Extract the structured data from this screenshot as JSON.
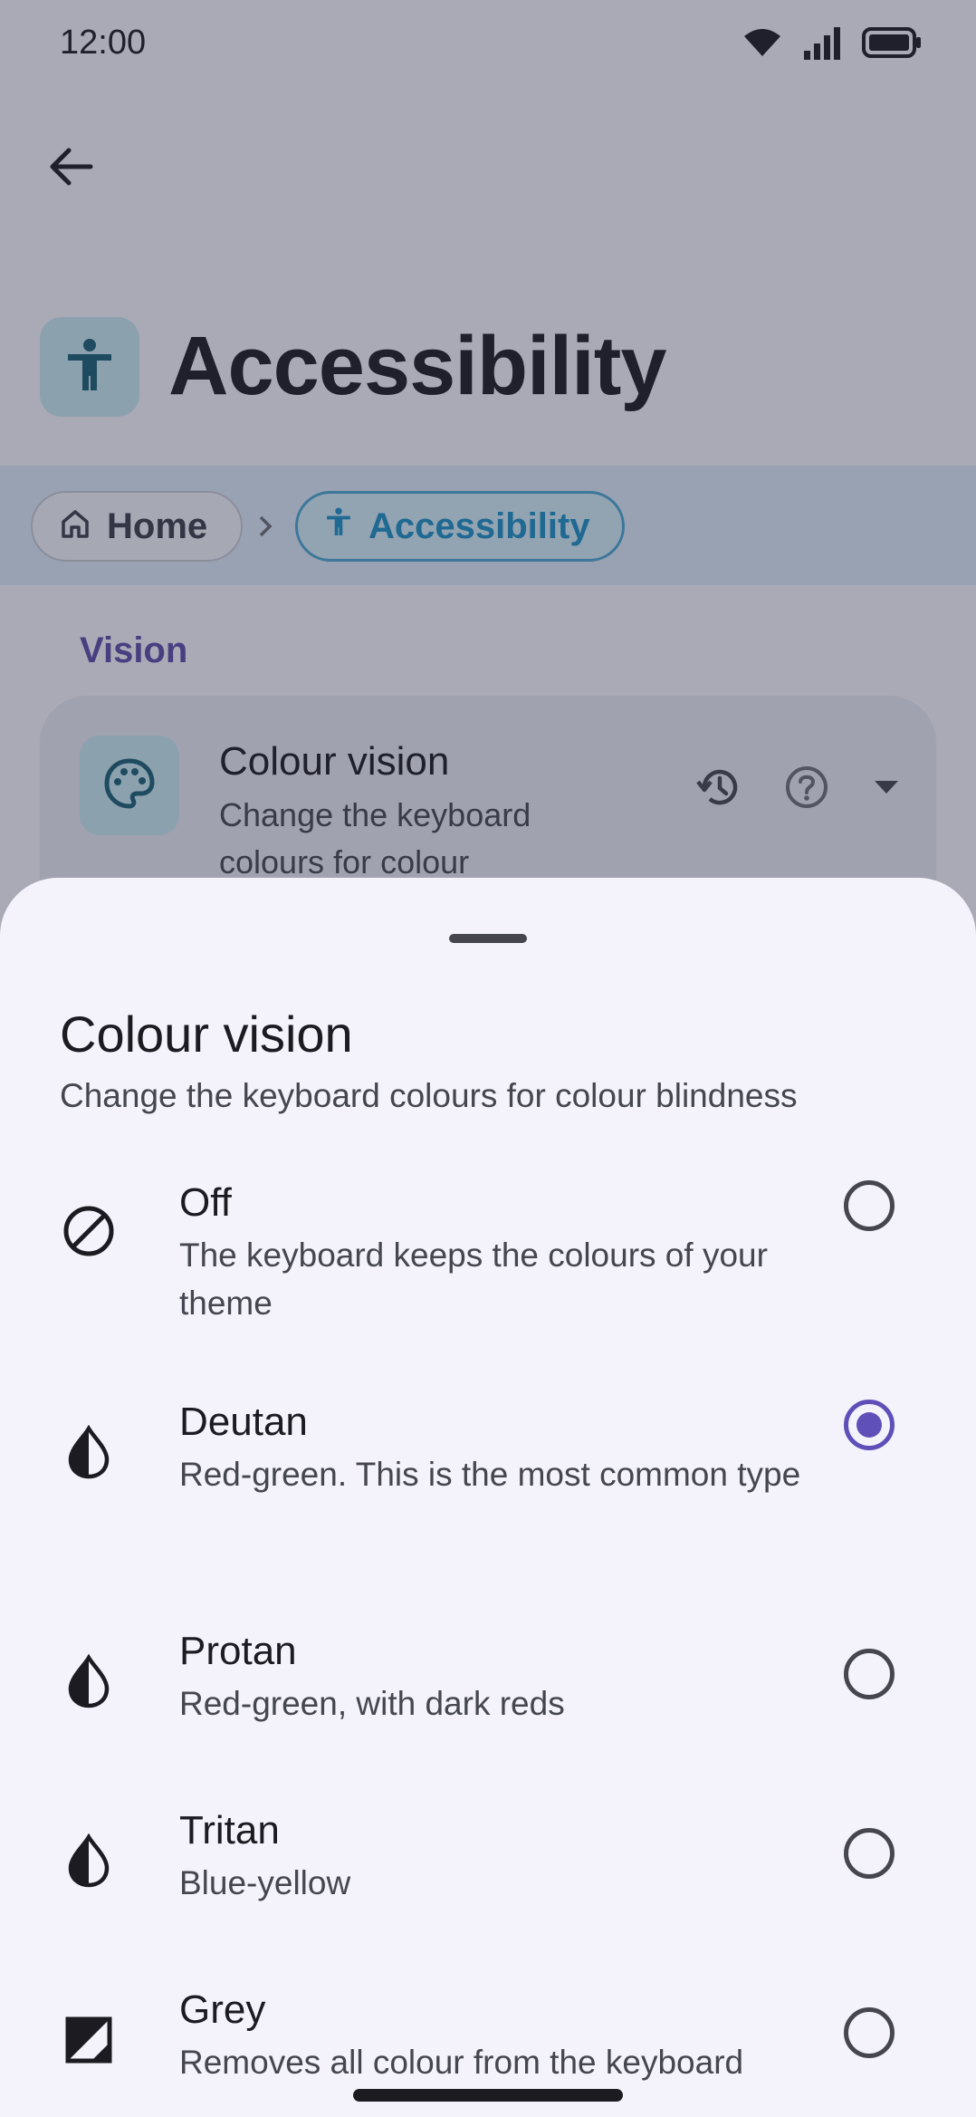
{
  "status_bar": {
    "time": "12:00"
  },
  "header": {
    "title": "Accessibility"
  },
  "breadcrumb": {
    "home": "Home",
    "current": "Accessibility"
  },
  "section": {
    "label": "Vision"
  },
  "card": {
    "title": "Colour vision",
    "subtitle": "Change the keyboard colours for colour"
  },
  "sheet": {
    "title": "Colour vision",
    "subtitle": "Change the keyboard colours for colour blindness",
    "options": [
      {
        "title": "Off",
        "description": "The keyboard keeps the colours of your theme",
        "icon": "block-icon",
        "selected": false
      },
      {
        "title": "Deutan",
        "description": "Red-green. This is the most common type",
        "icon": "contrast-drop-icon",
        "selected": true
      },
      {
        "title": "Protan",
        "description": "Red-green, with dark reds",
        "icon": "contrast-drop-icon",
        "selected": false
      },
      {
        "title": "Tritan",
        "description": "Blue-yellow",
        "icon": "contrast-drop-icon",
        "selected": false
      },
      {
        "title": "Grey",
        "description": "Removes all colour from the keyboard",
        "icon": "greyscale-icon",
        "selected": false
      }
    ]
  },
  "colors": {
    "accent": "#5e50b8",
    "section_label": "#5b4ba8",
    "breadcrumb_active": "#1b8ec2",
    "icon_tile": "#c6e5ee"
  }
}
